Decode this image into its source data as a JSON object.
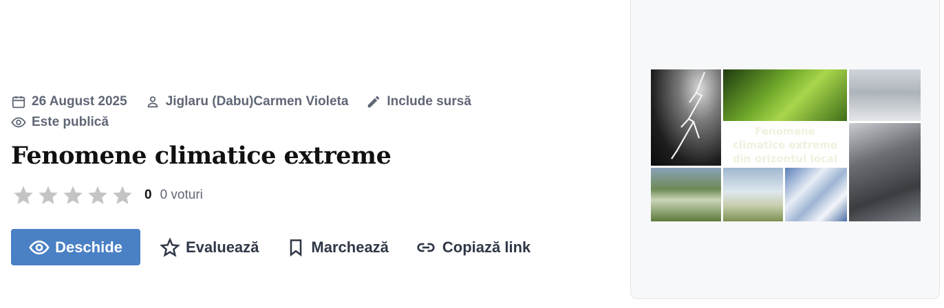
{
  "meta": {
    "date": "26 August 2025",
    "author": "Jiglaru (Dabu)Carmen Violeta",
    "source": "Include sursă",
    "visibility": "Este publică"
  },
  "title": "Fenomene climatice extreme",
  "rating": {
    "stars_total": 5,
    "stars_filled": 0,
    "count": "0",
    "votes": "0 voturi"
  },
  "actions": {
    "open": "Deschide",
    "rate": "Evaluează",
    "bookmark": "Marchează",
    "copy_link": "Copiază link"
  },
  "thumbnail": {
    "caption_lines": [
      "Fenomene",
      "climatice extreme",
      "din orizontul local"
    ]
  },
  "icons": {
    "date": "calendar-icon",
    "author": "person-icon",
    "source": "pencil-icon",
    "visibility": "eye-icon",
    "open": "eye-icon",
    "rate": "star-outline-icon",
    "bookmark": "bookmark-icon",
    "copy_link": "link-icon"
  },
  "colors": {
    "primary": "#4a80c4",
    "muted_text": "#5f6675",
    "star_empty": "#c4c4c4"
  }
}
